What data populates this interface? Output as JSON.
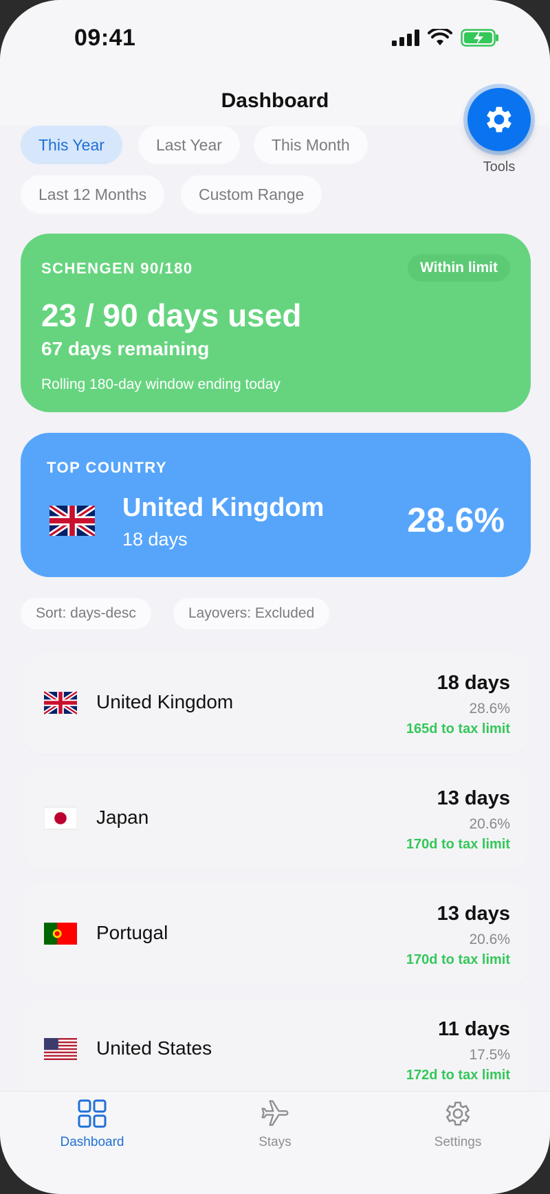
{
  "status_bar": {
    "time": "09:41"
  },
  "header": {
    "title": "Dashboard"
  },
  "tools": {
    "label": "Tools"
  },
  "filters": [
    {
      "label": "This Year",
      "active": true
    },
    {
      "label": "Last Year",
      "active": false
    },
    {
      "label": "This Month",
      "active": false
    },
    {
      "label": "Last 12 Months",
      "active": false
    },
    {
      "label": "Custom Range",
      "active": false
    }
  ],
  "schengen": {
    "title": "SCHENGEN 90/180",
    "badge": "Within limit",
    "used": "23 / 90 days used",
    "remaining": "67 days remaining",
    "note": "Rolling 180-day window ending today",
    "color": "#66d47f"
  },
  "top_country": {
    "label": "TOP COUNTRY",
    "name": "United Kingdom",
    "days": "18 days",
    "percent": "28.6%",
    "color": "#57a5fb"
  },
  "meta": {
    "sort": "Sort: days-desc",
    "layovers": "Layovers: Excluded"
  },
  "countries": [
    {
      "name": "United Kingdom",
      "flag": "uk-flag-icon",
      "days": "18 days",
      "percent": "28.6%",
      "tax": "165d to tax limit"
    },
    {
      "name": "Japan",
      "flag": "japan-flag-icon",
      "days": "13 days",
      "percent": "20.6%",
      "tax": "170d to tax limit"
    },
    {
      "name": "Portugal",
      "flag": "portugal-flag-icon",
      "days": "13 days",
      "percent": "20.6%",
      "tax": "170d to tax limit"
    },
    {
      "name": "United States",
      "flag": "us-flag-icon",
      "days": "11 days",
      "percent": "17.5%",
      "tax": "172d to tax limit"
    }
  ],
  "tabs": [
    {
      "label": "Dashboard",
      "icon": "grid-icon",
      "active": true
    },
    {
      "label": "Stays",
      "icon": "airplane-icon",
      "active": false
    },
    {
      "label": "Settings",
      "icon": "gear-icon",
      "active": false
    }
  ],
  "colors": {
    "accent": "#1f6fd6",
    "success": "#34c759"
  }
}
